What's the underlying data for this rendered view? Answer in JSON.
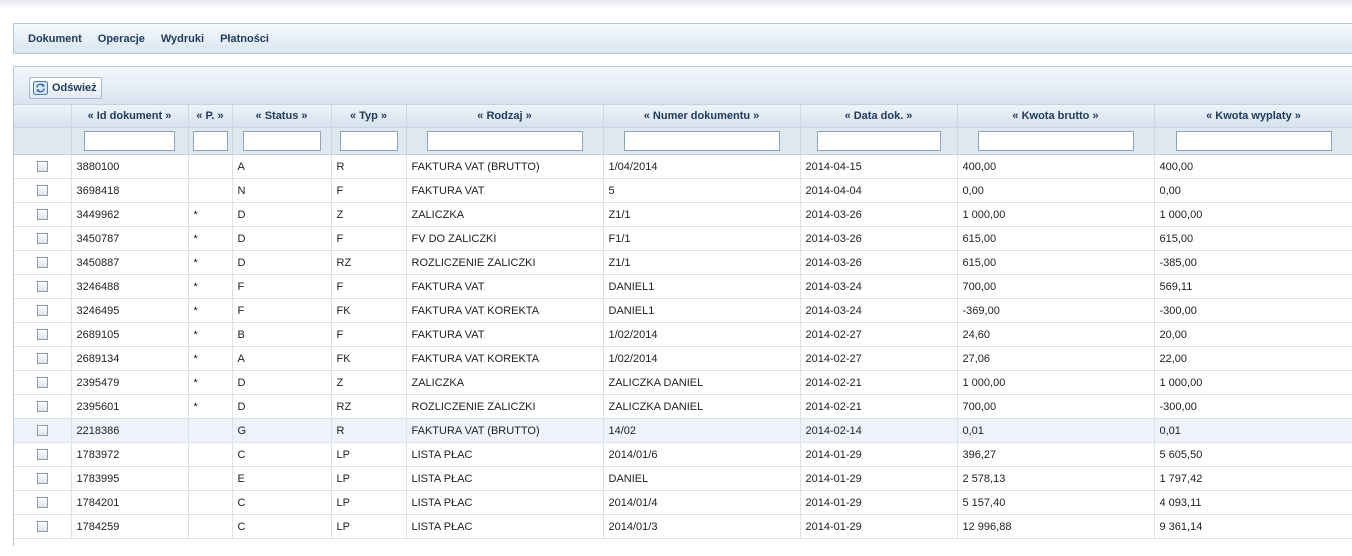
{
  "menu": [
    "Dokument",
    "Operacje",
    "Wydruki",
    "Płatności"
  ],
  "toolbar": {
    "refresh_label": "Odśwież"
  },
  "columns": [
    "« Id dokument »",
    "« P. »",
    "« Status »",
    "« Typ »",
    "« Rodzaj »",
    "« Numer dokumentu »",
    "« Data dok. »",
    "« Kwota brutto »",
    "« Kwota wyplaty »"
  ],
  "rows": [
    [
      "3880100",
      "",
      "A",
      "R",
      "FAKTURA VAT (BRUTTO)",
      "1/04/2014",
      "2014-04-15",
      "400,00",
      "400,00"
    ],
    [
      "3698418",
      "",
      "N",
      "F",
      "FAKTURA VAT",
      "5",
      "2014-04-04",
      "0,00",
      "0,00"
    ],
    [
      "3449962",
      "*",
      "D",
      "Z",
      "ZALICZKA",
      "Z1/1",
      "2014-03-26",
      "1 000,00",
      "1 000,00"
    ],
    [
      "3450787",
      "*",
      "D",
      "F",
      "FV DO ZALICZKI",
      "F1/1",
      "2014-03-26",
      "615,00",
      "615,00"
    ],
    [
      "3450887",
      "*",
      "D",
      "RZ",
      "ROZLICZENIE ZALICZKI",
      "Z1/1",
      "2014-03-26",
      "615,00",
      "-385,00"
    ],
    [
      "3246488",
      "*",
      "F",
      "F",
      "FAKTURA VAT",
      "DANIEL1",
      "2014-03-24",
      "700,00",
      "569,11"
    ],
    [
      "3246495",
      "*",
      "F",
      "FK",
      "FAKTURA VAT KOREKTA",
      "DANIEL1",
      "2014-03-24",
      "-369,00",
      "-300,00"
    ],
    [
      "2689105",
      "*",
      "B",
      "F",
      "FAKTURA VAT",
      "1/02/2014",
      "2014-02-27",
      "24,60",
      "20,00"
    ],
    [
      "2689134",
      "*",
      "A",
      "FK",
      "FAKTURA VAT KOREKTA",
      "1/02/2014",
      "2014-02-27",
      "27,06",
      "22,00"
    ],
    [
      "2395479",
      "*",
      "D",
      "Z",
      "ZALICZKA",
      "ZALICZKA DANIEL",
      "2014-02-21",
      "1 000,00",
      "1 000,00"
    ],
    [
      "2395601",
      "*",
      "D",
      "RZ",
      "ROZLICZENIE ZALICZKI",
      "ZALICZKA DANIEL",
      "2014-02-21",
      "700,00",
      "-300,00"
    ],
    [
      "2218386",
      "",
      "G",
      "R",
      "FAKTURA VAT (BRUTTO)",
      "14/02",
      "2014-02-14",
      "0,01",
      "0,01"
    ],
    [
      "1783972",
      "",
      "C",
      "LP",
      "LISTA PŁAC",
      "2014/01/6",
      "2014-01-29",
      "396,27",
      "5 605,50"
    ],
    [
      "1783995",
      "",
      "E",
      "LP",
      "LISTA PŁAC",
      "DANIEL",
      "2014-01-29",
      "2 578,13",
      "1 797,42"
    ],
    [
      "1784201",
      "",
      "C",
      "LP",
      "LISTA PŁAC",
      "2014/01/4",
      "2014-01-29",
      "5 157,40",
      "4 093,11"
    ],
    [
      "1784259",
      "",
      "C",
      "LP",
      "LISTA PŁAC",
      "2014/01/3",
      "2014-01-29",
      "12 996,88",
      "9 361,14"
    ]
  ],
  "highlighted_row": 11
}
